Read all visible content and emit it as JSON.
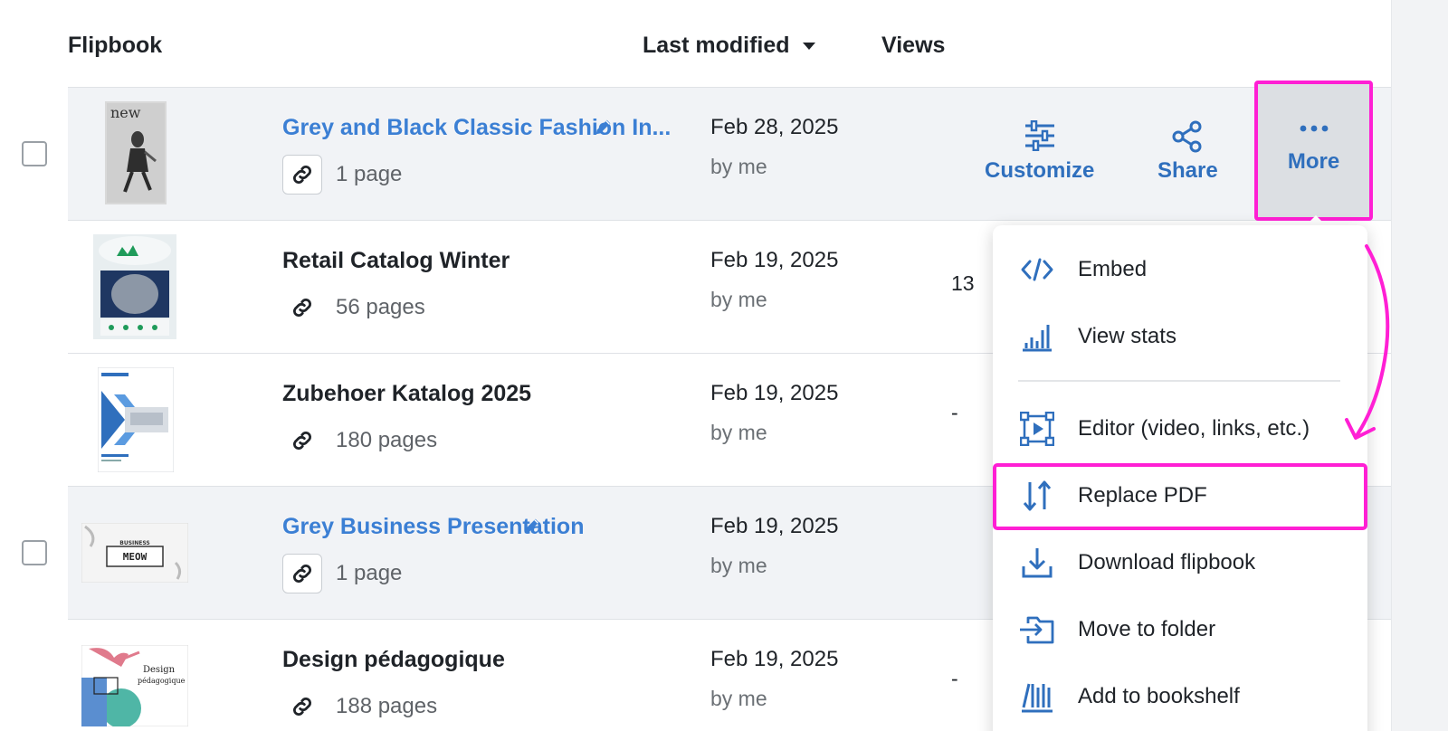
{
  "header": {
    "flipbook": "Flipbook",
    "last_modified": "Last modified",
    "views": "Views"
  },
  "rows": [
    {
      "title": "Grey and Black Classic Fashion In...",
      "pages": "1 page",
      "date": "Feb 28, 2025",
      "by": "by me",
      "views": "",
      "thumb_text": "new"
    },
    {
      "title": "Retail Catalog Winter",
      "pages": "56 pages",
      "date": "Feb 19, 2025",
      "by": "by me",
      "views": "13"
    },
    {
      "title": "Zubehoer Katalog 2025",
      "pages": "180 pages",
      "date": "Feb 19, 2025",
      "by": "by me",
      "views": "-"
    },
    {
      "title": "Grey Business Presentation",
      "pages": "1 page",
      "date": "Feb 19, 2025",
      "by": "by me",
      "views": "",
      "thumb_text_1": "BUSINESS",
      "thumb_text_2": "MEOW"
    },
    {
      "title": "Design pédagogique",
      "pages": "188 pages",
      "date": "Feb 19, 2025",
      "by": "by me",
      "views": "-",
      "thumb_text": "Design pédagogique"
    }
  ],
  "actions": {
    "customize": "Customize",
    "share": "Share",
    "more": "More"
  },
  "menu": {
    "embed": "Embed",
    "view_stats": "View stats",
    "editor": "Editor (video, links, etc.)",
    "replace_pdf": "Replace PDF",
    "download": "Download flipbook",
    "move": "Move to folder",
    "bookshelf": "Add to bookshelf"
  },
  "colors": {
    "link_blue": "#3b7fd4",
    "action_blue": "#2f6fbd",
    "highlight_magenta": "#ff1fd4",
    "row_highlight": "#f1f3f6"
  }
}
